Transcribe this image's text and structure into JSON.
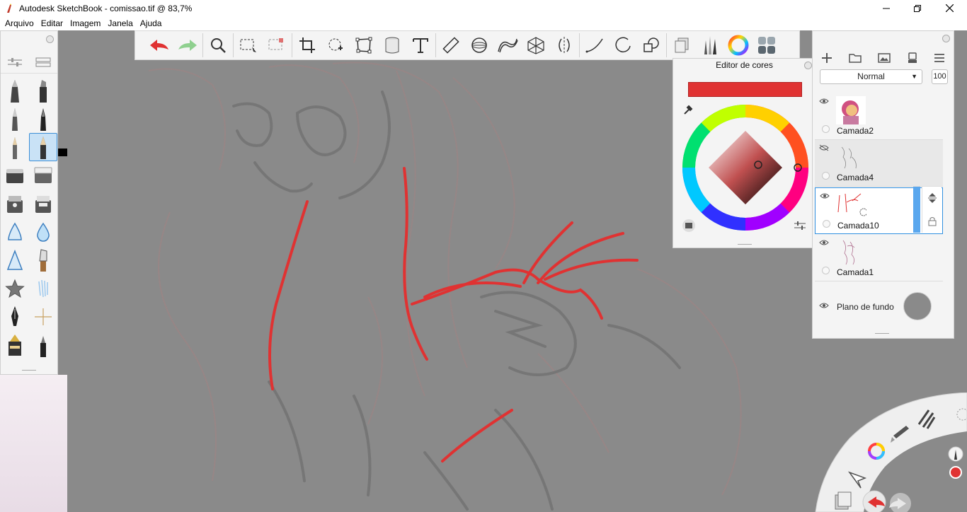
{
  "titlebar": {
    "title": "Autodesk SketchBook - comissao.tif @ 83,7%",
    "minimize_icon": "minimize-icon",
    "maximize_icon": "restore-icon",
    "close_icon": "close-icon"
  },
  "menu": [
    "Arquivo",
    "Editar",
    "Imagem",
    "Janela",
    "Ajuda"
  ],
  "toolbar": {
    "tools": [
      "undo",
      "redo",
      "zoom",
      "select-rect",
      "select-lasso",
      "crop",
      "transform",
      "distort",
      "fill",
      "text",
      "ruler",
      "ellipse-guide",
      "french-curve",
      "perspective",
      "symmetry",
      "stroke",
      "shape",
      "predictive-stroke",
      "copy-layer",
      "brushes",
      "color-wheel",
      "panels"
    ]
  },
  "color_editor": {
    "title": "Editor de cores",
    "current_color": "#e03232"
  },
  "layers": {
    "blend_mode": "Normal",
    "opacity": "100",
    "items": [
      {
        "name": "Camada2",
        "visible": true
      },
      {
        "name": "Camada4",
        "visible": false
      },
      {
        "name": "Camada10",
        "visible": true,
        "active": true
      },
      {
        "name": "Camada1",
        "visible": true
      }
    ],
    "background": {
      "name": "Plano de fundo",
      "color": "#8a8a8a"
    }
  },
  "colors": {
    "stroke_red": "#e03232",
    "canvas_gray": "#8a8a8a",
    "accent_blue": "#2f8fe0"
  }
}
